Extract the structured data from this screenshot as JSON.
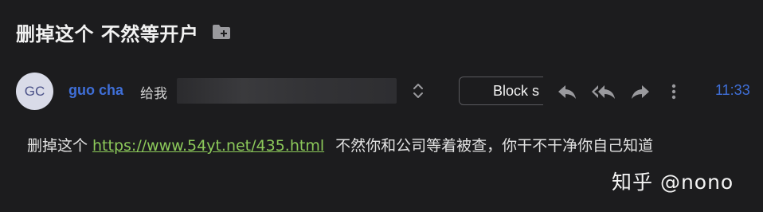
{
  "email": {
    "subject": "删掉这个 不然等开户",
    "sender": {
      "initials": "GC",
      "name": "guo cha"
    },
    "to_label": "给我",
    "block_label": "Block s",
    "time": "11:33",
    "body": {
      "prefix": "删掉这个",
      "link": "https://www.54yt.net/435.html",
      "suffix": "不然你和公司等着被查，你干不干净你自己知道"
    }
  },
  "icons": {
    "subject": "folder-add-icon",
    "expand": "chevron-up-down-icon",
    "actions": [
      "reply-icon",
      "reply-all-icon",
      "forward-icon",
      "more-vertical-icon"
    ]
  },
  "watermark": "知乎 @nono",
  "colors": {
    "background": "#1c1c1e",
    "accent": "#3f6fd8",
    "link": "#8cc95a",
    "icon": "#9a9a9e"
  }
}
